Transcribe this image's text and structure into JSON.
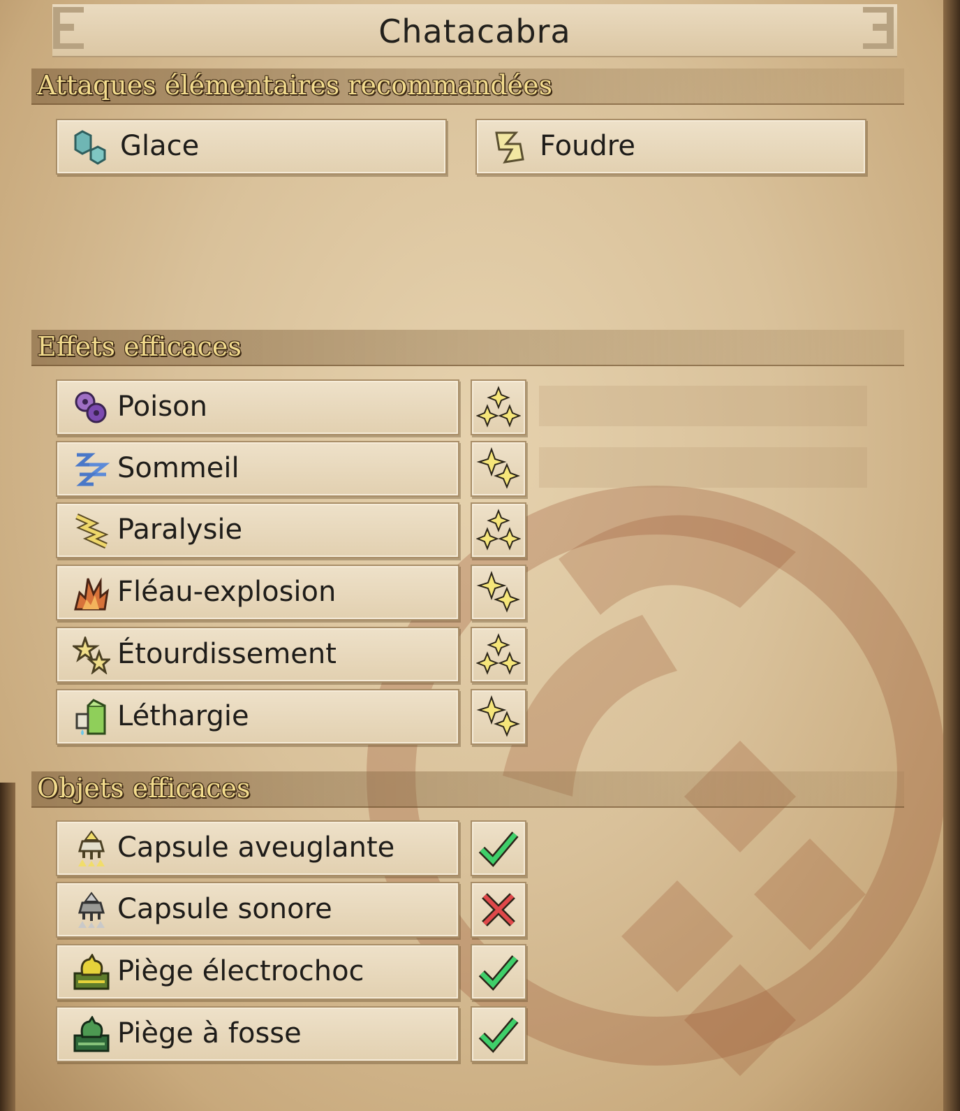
{
  "title": "Chatacabra",
  "elemental": {
    "header": "Attaques élémentaires recommandées",
    "items": [
      {
        "label": "Glace",
        "icon": "ice-crystal-icon"
      },
      {
        "label": "Foudre",
        "icon": "thunder-bolt-icon"
      }
    ]
  },
  "effects": {
    "header": "Effets efficaces",
    "items": [
      {
        "label": "Poison",
        "icon": "poison-icon",
        "rating": "three-stars"
      },
      {
        "label": "Sommeil",
        "icon": "sleep-icon",
        "rating": "two-stars"
      },
      {
        "label": "Paralysie",
        "icon": "paralysis-icon",
        "rating": "three-stars"
      },
      {
        "label": "Fléau-explosion",
        "icon": "blast-icon",
        "rating": "two-stars"
      },
      {
        "label": "Étourdissement",
        "icon": "stun-icon",
        "rating": "three-stars"
      },
      {
        "label": "Léthargie",
        "icon": "exhaust-icon",
        "rating": "two-stars"
      }
    ]
  },
  "items": {
    "header": "Objets efficaces",
    "items": [
      {
        "label": "Capsule aveuglante",
        "icon": "flash-pod-icon",
        "effective": true
      },
      {
        "label": "Capsule sonore",
        "icon": "sonic-pod-icon",
        "effective": false
      },
      {
        "label": "Piège électrochoc",
        "icon": "shock-trap-icon",
        "effective": true
      },
      {
        "label": "Piège à fosse",
        "icon": "pitfall-trap-icon",
        "effective": true
      }
    ]
  },
  "colors": {
    "parchment": "#d9c19a",
    "header_text": "#f3dc8e",
    "check": "#3fcf6a",
    "cross": "#e0484a",
    "star": "#f6e67a"
  }
}
